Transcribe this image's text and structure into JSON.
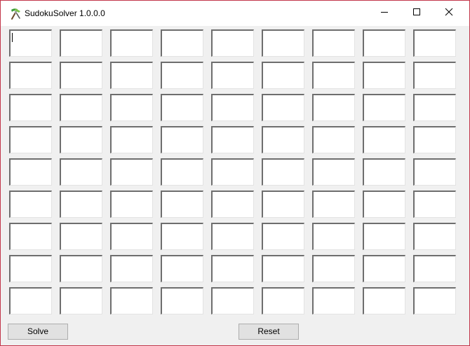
{
  "window": {
    "title": "SudokuSolver 1.0.0.0",
    "app_icon": "tool-icon",
    "controls": {
      "minimize_icon": "minimize-icon",
      "maximize_icon": "maximize-icon",
      "close_icon": "close-icon"
    }
  },
  "grid": {
    "rows": 9,
    "cols": 9,
    "values": [
      [
        "",
        "",
        "",
        "",
        "",
        "",
        "",
        "",
        ""
      ],
      [
        "",
        "",
        "",
        "",
        "",
        "",
        "",
        "",
        ""
      ],
      [
        "",
        "",
        "",
        "",
        "",
        "",
        "",
        "",
        ""
      ],
      [
        "",
        "",
        "",
        "",
        "",
        "",
        "",
        "",
        ""
      ],
      [
        "",
        "",
        "",
        "",
        "",
        "",
        "",
        "",
        ""
      ],
      [
        "",
        "",
        "",
        "",
        "",
        "",
        "",
        "",
        ""
      ],
      [
        "",
        "",
        "",
        "",
        "",
        "",
        "",
        "",
        ""
      ],
      [
        "",
        "",
        "",
        "",
        "",
        "",
        "",
        "",
        ""
      ],
      [
        "",
        "",
        "",
        "",
        "",
        "",
        "",
        "",
        ""
      ]
    ]
  },
  "actions": {
    "solve_label": "Solve",
    "reset_label": "Reset"
  },
  "colors": {
    "window_border": "#c2364a",
    "client_background": "#f0f0f0",
    "button_face": "#e1e1e1"
  }
}
